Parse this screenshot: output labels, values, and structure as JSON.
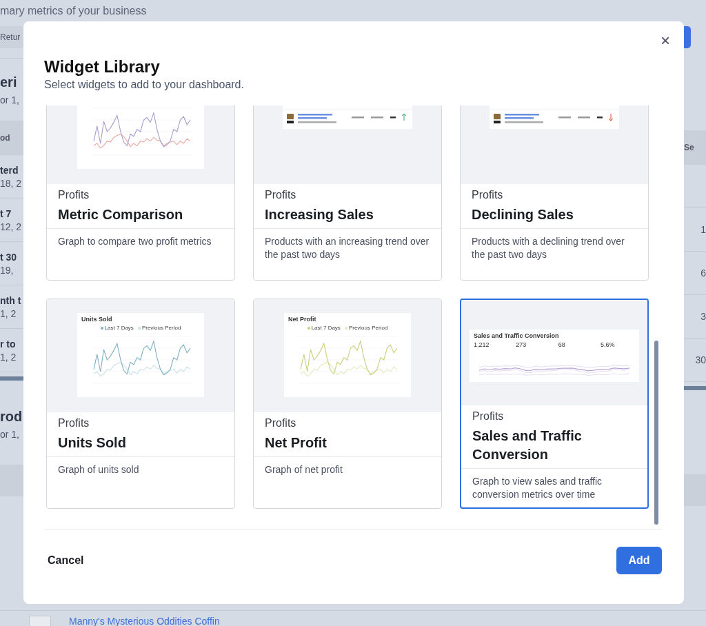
{
  "background": {
    "subtitle": "mary metrics of your business",
    "left_button": "Retur",
    "section_title": "eri",
    "section_date": "or 1,",
    "table_header": "od",
    "right_header": "Se",
    "rows": [
      {
        "name": "terd",
        "date": "18, 2"
      },
      {
        "name": "t 7",
        "date": "12, 2",
        "value": "1"
      },
      {
        "name": "t 30",
        "date": "19,",
        "value": "6"
      },
      {
        "name": "nth t",
        "date": "1, 2",
        "value": "3"
      },
      {
        "name": "r to",
        "date": "1, 2",
        "value": "30"
      }
    ],
    "section2_title": "rod",
    "section2_date": "or 1,",
    "product_link": "Manny's Mysterious Oddities Coffin"
  },
  "modal": {
    "title": "Widget Library",
    "subtitle": "Select widgets to add to your dashboard.",
    "close": "×",
    "cards": [
      {
        "category": "Profits",
        "title": "Metric Comparison",
        "description": "Graph to compare two profit metrics",
        "selected": false,
        "preview": {
          "kind": "line",
          "series": [
            {
              "color": "#a99bd0"
            },
            {
              "color": "#e8a9a0"
            }
          ]
        }
      },
      {
        "category": "Profits",
        "title": "Increasing Sales",
        "description": "Products with an increasing trend over the past two days",
        "selected": false,
        "preview": {
          "kind": "increasing"
        }
      },
      {
        "category": "Profits",
        "title": "Declining Sales",
        "description": "Products with a declining trend over the past two days",
        "selected": false,
        "preview": {
          "kind": "declining"
        }
      },
      {
        "category": "Profits",
        "title": "Units Sold",
        "description": "Graph of units sold",
        "selected": false,
        "preview": {
          "kind": "line",
          "series": [
            {
              "color": "#7fb0c4",
              "name": "Last 7 Days"
            },
            {
              "color": "#c9e0e6",
              "name": "Previous Period"
            }
          ],
          "title": "Units Sold"
        }
      },
      {
        "category": "Profits",
        "title": "Net Profit",
        "description": "Graph of net profit",
        "selected": false,
        "preview": {
          "kind": "line",
          "series": [
            {
              "color": "#c9cf7a",
              "name": "Last 7 Days"
            },
            {
              "color": "#e6e9bd",
              "name": "Previous Period"
            }
          ],
          "title": "Net Profit"
        }
      },
      {
        "category": "Profits",
        "title": "Sales and Traffic Conversion",
        "description": "Graph to view sales and traffic conversion metrics over time",
        "selected": true,
        "preview": {
          "kind": "traffic",
          "series": [
            {
              "color": "#b9a3d6"
            }
          ],
          "title": "Sales and Traffic Conversion",
          "stats": [
            "1,212",
            "273",
            "68",
            "5.6%"
          ]
        }
      }
    ],
    "cancel": "Cancel",
    "add": "Add"
  }
}
